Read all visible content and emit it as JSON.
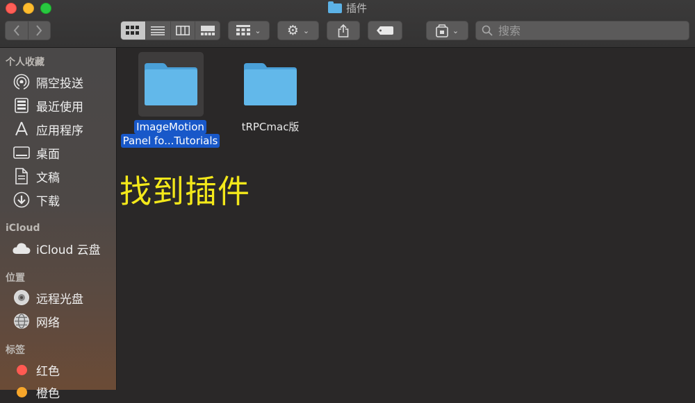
{
  "window": {
    "title": "插件"
  },
  "search": {
    "placeholder": "搜索"
  },
  "sidebar": {
    "sections": [
      {
        "header": "个人收藏",
        "items": [
          {
            "label": "隔空投送",
            "icon": "airdrop-icon"
          },
          {
            "label": "最近使用",
            "icon": "recents-icon"
          },
          {
            "label": "应用程序",
            "icon": "applications-icon"
          },
          {
            "label": "桌面",
            "icon": "desktop-icon"
          },
          {
            "label": "文稿",
            "icon": "documents-icon"
          },
          {
            "label": "下载",
            "icon": "downloads-icon"
          }
        ]
      },
      {
        "header": "iCloud",
        "items": [
          {
            "label": "iCloud 云盘",
            "icon": "cloud-icon"
          }
        ]
      },
      {
        "header": "位置",
        "items": [
          {
            "label": "远程光盘",
            "icon": "disc-icon"
          },
          {
            "label": "网络",
            "icon": "network-icon"
          }
        ]
      },
      {
        "header": "标签",
        "items": [
          {
            "label": "红色",
            "icon": "tag-dot-icon",
            "color": "#ff5a52"
          },
          {
            "label": "橙色",
            "icon": "tag-dot-icon",
            "color": "#f7a62a"
          }
        ]
      }
    ]
  },
  "files": [
    {
      "name_line1": "ImageMotion",
      "name_line2": "Panel fo...Tutorials",
      "selected": true
    },
    {
      "name_line1": "tRPCmac版",
      "selected": false
    }
  ],
  "overlay_text": "找到插件",
  "colors": {
    "folder": "#5cb2e6",
    "selection": "#1858c9",
    "overlay": "#f3e81a"
  }
}
